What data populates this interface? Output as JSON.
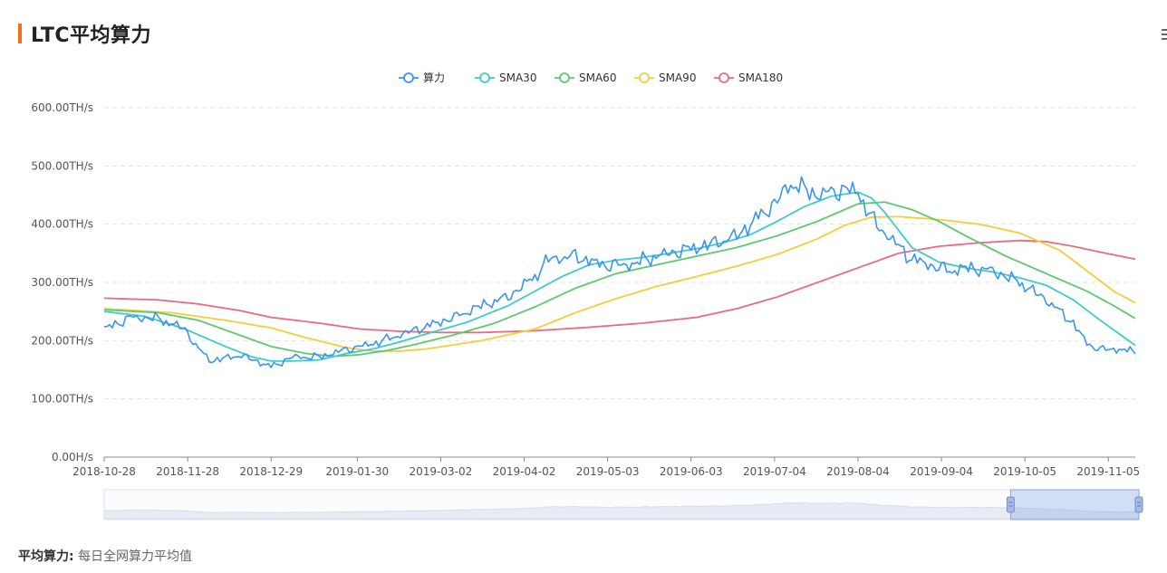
{
  "title": "LTC平均算力",
  "footer": {
    "label": "平均算力:",
    "text": "每日全网算力平均值"
  },
  "chart_data": {
    "type": "line",
    "ylim": [
      0,
      600
    ],
    "y_ticks": [
      "0.00H/s",
      "100.00TH/s",
      "200.00TH/s",
      "300.00TH/s",
      "400.00TH/s",
      "500.00TH/s",
      "600.00TH/s"
    ],
    "x_ticks": [
      "2018-10-28",
      "2018-11-28",
      "2018-12-29",
      "2019-01-30",
      "2019-03-02",
      "2019-04-02",
      "2019-05-03",
      "2019-06-03",
      "2019-07-04",
      "2019-08-04",
      "2019-09-04",
      "2019-10-05",
      "2019-11-05"
    ],
    "x_tick_index": [
      0,
      31,
      62,
      94,
      125,
      156,
      187,
      218,
      249,
      280,
      311,
      342,
      373
    ],
    "n_points": 384,
    "grid": true,
    "legend_position": "top-center",
    "series": [
      {
        "name": "算力",
        "color": "#3a95f0",
        "anchors": [
          [
            0,
            220
          ],
          [
            10,
            240
          ],
          [
            20,
            238
          ],
          [
            30,
            220
          ],
          [
            35,
            185
          ],
          [
            40,
            165
          ],
          [
            50,
            175
          ],
          [
            55,
            168
          ],
          [
            62,
            155
          ],
          [
            70,
            172
          ],
          [
            80,
            172
          ],
          [
            90,
            185
          ],
          [
            100,
            195
          ],
          [
            110,
            210
          ],
          [
            120,
            225
          ],
          [
            130,
            240
          ],
          [
            140,
            260
          ],
          [
            150,
            275
          ],
          [
            160,
            310
          ],
          [
            165,
            340
          ],
          [
            175,
            345
          ],
          [
            185,
            330
          ],
          [
            195,
            330
          ],
          [
            205,
            345
          ],
          [
            215,
            355
          ],
          [
            225,
            365
          ],
          [
            235,
            380
          ],
          [
            240,
            400
          ],
          [
            250,
            440
          ],
          [
            255,
            470
          ],
          [
            265,
            450
          ],
          [
            275,
            460
          ],
          [
            280,
            455
          ],
          [
            285,
            410
          ],
          [
            290,
            385
          ],
          [
            300,
            340
          ],
          [
            310,
            325
          ],
          [
            315,
            320
          ],
          [
            320,
            325
          ],
          [
            330,
            320
          ],
          [
            340,
            300
          ],
          [
            350,
            270
          ],
          [
            360,
            230
          ],
          [
            365,
            195
          ],
          [
            370,
            185
          ],
          [
            378,
            185
          ],
          [
            383,
            180
          ]
        ],
        "noise": 9
      },
      {
        "name": "SMA30",
        "color": "#3ecbc9",
        "anchors": [
          [
            0,
            250
          ],
          [
            15,
            242
          ],
          [
            30,
            220
          ],
          [
            45,
            190
          ],
          [
            55,
            172
          ],
          [
            62,
            165
          ],
          [
            70,
            165
          ],
          [
            80,
            167
          ],
          [
            90,
            178
          ],
          [
            100,
            186
          ],
          [
            110,
            198
          ],
          [
            120,
            212
          ],
          [
            135,
            232
          ],
          [
            150,
            260
          ],
          [
            160,
            285
          ],
          [
            170,
            310
          ],
          [
            180,
            330
          ],
          [
            190,
            338
          ],
          [
            200,
            343
          ],
          [
            210,
            350
          ],
          [
            220,
            358
          ],
          [
            230,
            368
          ],
          [
            240,
            382
          ],
          [
            250,
            405
          ],
          [
            260,
            430
          ],
          [
            270,
            448
          ],
          [
            280,
            455
          ],
          [
            285,
            445
          ],
          [
            290,
            420
          ],
          [
            300,
            360
          ],
          [
            310,
            335
          ],
          [
            320,
            325
          ],
          [
            330,
            318
          ],
          [
            340,
            308
          ],
          [
            350,
            295
          ],
          [
            360,
            270
          ],
          [
            370,
            235
          ],
          [
            383,
            192
          ]
        ]
      },
      {
        "name": "SMA60",
        "color": "#5cca6c",
        "anchors": [
          [
            0,
            253
          ],
          [
            20,
            248
          ],
          [
            35,
            235
          ],
          [
            50,
            210
          ],
          [
            62,
            190
          ],
          [
            75,
            178
          ],
          [
            85,
            173
          ],
          [
            95,
            176
          ],
          [
            105,
            183
          ],
          [
            115,
            193
          ],
          [
            130,
            210
          ],
          [
            145,
            230
          ],
          [
            160,
            258
          ],
          [
            175,
            290
          ],
          [
            190,
            315
          ],
          [
            205,
            330
          ],
          [
            220,
            345
          ],
          [
            235,
            360
          ],
          [
            250,
            380
          ],
          [
            265,
            405
          ],
          [
            280,
            435
          ],
          [
            290,
            438
          ],
          [
            300,
            425
          ],
          [
            310,
            405
          ],
          [
            320,
            380
          ],
          [
            335,
            345
          ],
          [
            350,
            315
          ],
          [
            365,
            285
          ],
          [
            375,
            260
          ],
          [
            383,
            238
          ]
        ]
      },
      {
        "name": "SMA90",
        "color": "#f6cc3a",
        "anchors": [
          [
            0,
            255
          ],
          [
            25,
            248
          ],
          [
            45,
            235
          ],
          [
            62,
            222
          ],
          [
            75,
            205
          ],
          [
            90,
            188
          ],
          [
            100,
            182
          ],
          [
            110,
            182
          ],
          [
            120,
            186
          ],
          [
            140,
            200
          ],
          [
            160,
            220
          ],
          [
            175,
            248
          ],
          [
            190,
            272
          ],
          [
            205,
            293
          ],
          [
            220,
            310
          ],
          [
            235,
            328
          ],
          [
            250,
            348
          ],
          [
            265,
            375
          ],
          [
            275,
            398
          ],
          [
            285,
            412
          ],
          [
            295,
            413
          ],
          [
            310,
            408
          ],
          [
            325,
            400
          ],
          [
            340,
            385
          ],
          [
            355,
            355
          ],
          [
            365,
            320
          ],
          [
            375,
            285
          ],
          [
            383,
            265
          ]
        ]
      },
      {
        "name": "SMA180",
        "color": "#ec6a81",
        "anchors": [
          [
            0,
            273
          ],
          [
            20,
            270
          ],
          [
            35,
            263
          ],
          [
            50,
            252
          ],
          [
            62,
            240
          ],
          [
            80,
            230
          ],
          [
            95,
            220
          ],
          [
            110,
            216
          ],
          [
            125,
            214
          ],
          [
            140,
            214
          ],
          [
            160,
            217
          ],
          [
            180,
            223
          ],
          [
            200,
            230
          ],
          [
            220,
            240
          ],
          [
            235,
            255
          ],
          [
            250,
            275
          ],
          [
            265,
            300
          ],
          [
            280,
            325
          ],
          [
            295,
            350
          ],
          [
            310,
            362
          ],
          [
            325,
            368
          ],
          [
            340,
            372
          ],
          [
            350,
            370
          ],
          [
            360,
            362
          ],
          [
            370,
            352
          ],
          [
            383,
            340
          ]
        ]
      }
    ]
  },
  "navigator": {
    "range_start": 0.876,
    "range_end": 1.0
  }
}
